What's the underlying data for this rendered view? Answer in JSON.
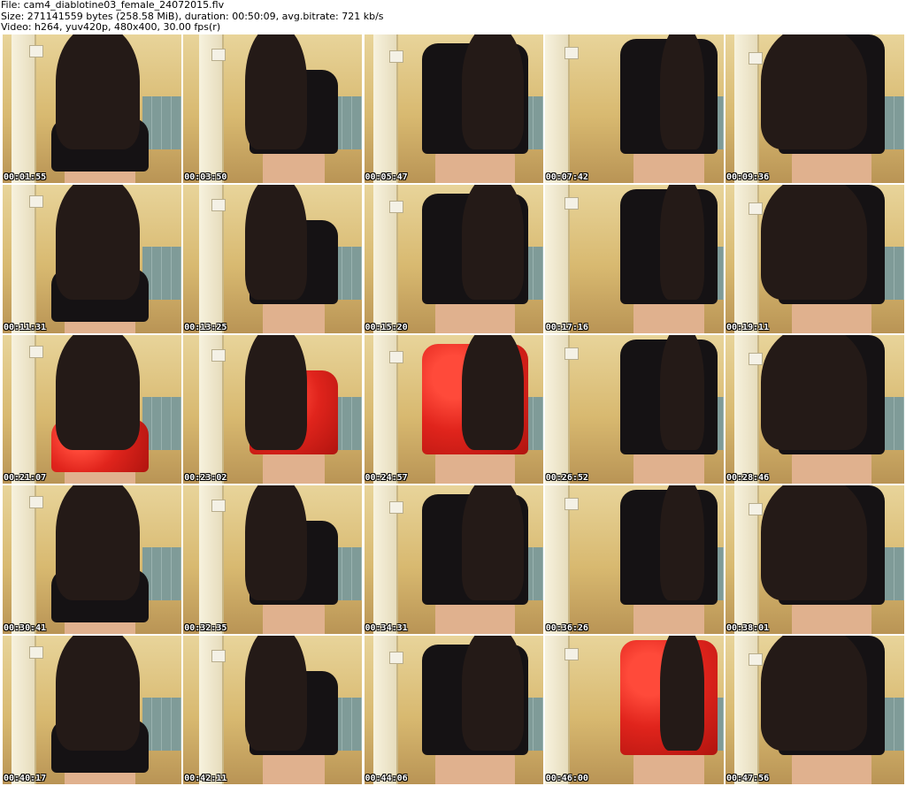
{
  "header": {
    "file_line": "File: cam4_diablotine03_female_24072015.flv",
    "size_line": "Size: 271141559 bytes (258.58 MiB), duration: 00:50:09, avg.bitrate: 721 kb/s",
    "video_line": "Video: h264, yuv420p, 480x400, 30.00 fps(r)"
  },
  "colors": {
    "black_dress": "#151214",
    "red_lingerie": "#e0241c",
    "skin": "#d9a684",
    "hair": "#241a17",
    "wall": "#e8d49a",
    "tiles": "#7f9b98"
  },
  "thumbnails": [
    {
      "timestamp": "00:01:55",
      "outfit": "black"
    },
    {
      "timestamp": "00:03:50",
      "outfit": "black"
    },
    {
      "timestamp": "00:05:47",
      "outfit": "black"
    },
    {
      "timestamp": "00:07:42",
      "outfit": "black"
    },
    {
      "timestamp": "00:09:36",
      "outfit": "black"
    },
    {
      "timestamp": "00:11:31",
      "outfit": "black"
    },
    {
      "timestamp": "00:13:25",
      "outfit": "black"
    },
    {
      "timestamp": "00:15:20",
      "outfit": "black"
    },
    {
      "timestamp": "00:17:16",
      "outfit": "black"
    },
    {
      "timestamp": "00:19:11",
      "outfit": "black"
    },
    {
      "timestamp": "00:21:07",
      "outfit": "red"
    },
    {
      "timestamp": "00:23:02",
      "outfit": "red"
    },
    {
      "timestamp": "00:24:57",
      "outfit": "red"
    },
    {
      "timestamp": "00:26:52",
      "outfit": "black"
    },
    {
      "timestamp": "00:28:46",
      "outfit": "black"
    },
    {
      "timestamp": "00:30:41",
      "outfit": "black"
    },
    {
      "timestamp": "00:32:35",
      "outfit": "black"
    },
    {
      "timestamp": "00:34:31",
      "outfit": "black"
    },
    {
      "timestamp": "00:36:26",
      "outfit": "black"
    },
    {
      "timestamp": "00:38:01",
      "outfit": "black"
    },
    {
      "timestamp": "00:40:17",
      "outfit": "black"
    },
    {
      "timestamp": "00:42:11",
      "outfit": "black"
    },
    {
      "timestamp": "00:44:06",
      "outfit": "black"
    },
    {
      "timestamp": "00:46:00",
      "outfit": "red"
    },
    {
      "timestamp": "00:47:56",
      "outfit": "black"
    }
  ]
}
